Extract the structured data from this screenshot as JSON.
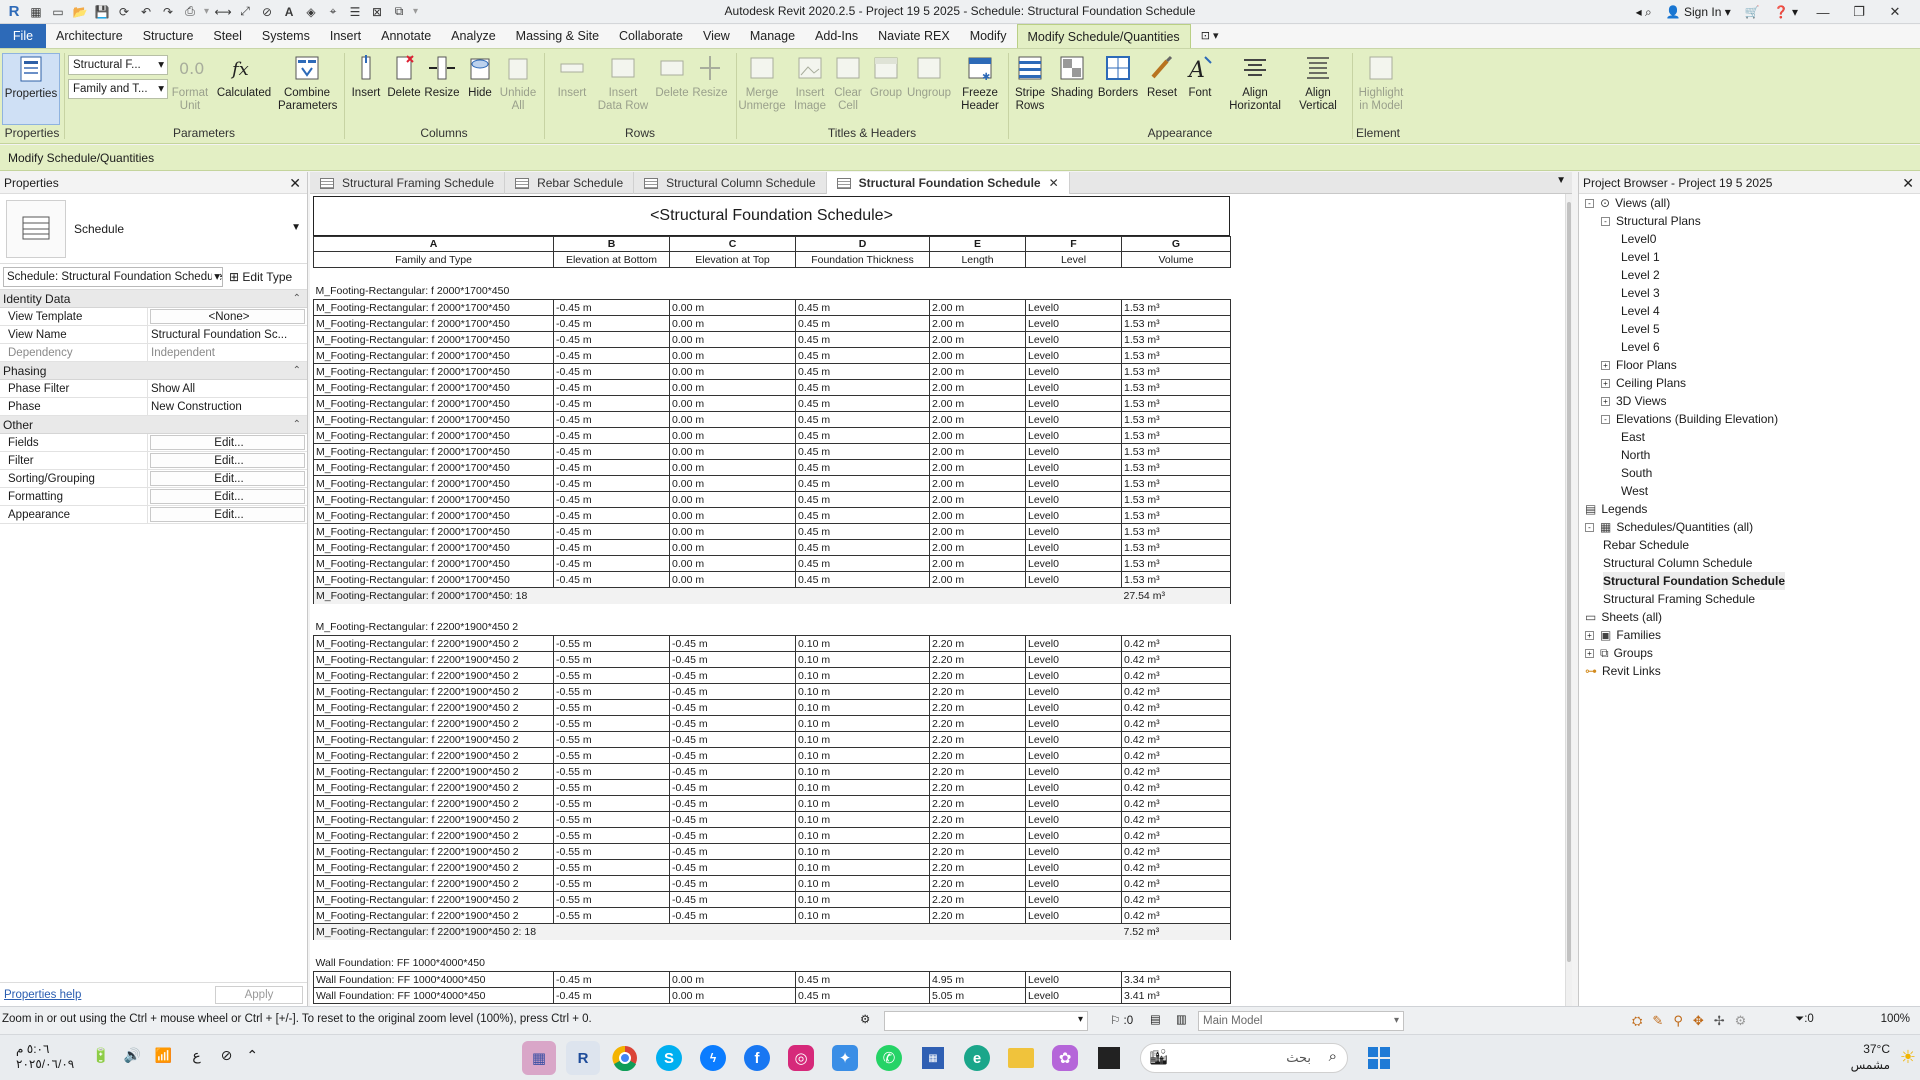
{
  "titlebar": {
    "title": "Autodesk Revit 2020.2.5 - Project   19 5 2025 - Schedule: Structural Foundation Schedule",
    "sign_in": "Sign In"
  },
  "ribbon_tabs": [
    "File",
    "Architecture",
    "Structure",
    "Steel",
    "Systems",
    "Insert",
    "Annotate",
    "Analyze",
    "Massing & Site",
    "Collaborate",
    "View",
    "Manage",
    "Add-Ins",
    "Naviate REX",
    "Modify",
    "Modify Schedule/Quantities"
  ],
  "ribbon": {
    "properties_label": "Properties",
    "param_dropdown1": "Structural F...",
    "param_dropdown2": "Family and T...",
    "buttons": {
      "format_unit": "Format\nUnit",
      "calculated": "Calculated",
      "combine_parameters": "Combine\nParameters",
      "insert_col": "Insert",
      "delete_col": "Delete",
      "resize_col": "Resize",
      "hide": "Hide",
      "unhide_all": "Unhide\nAll",
      "insert_row": "Insert",
      "insert_data_row": "Insert\nData Row",
      "delete_row": "Delete",
      "resize_row": "Resize",
      "merge_unmerge": "Merge\nUnmerge",
      "insert_image": "Insert\nImage",
      "clear_cell": "Clear\nCell",
      "group": "Group",
      "ungroup": "Ungroup",
      "freeze_header": "Freeze\nHeader",
      "stripe_rows": "Stripe\nRows",
      "shading": "Shading",
      "borders": "Borders",
      "reset": "Reset",
      "font": "Font",
      "align_horizontal": "Align\nHorizontal",
      "align_vertical": "Align\nVertical",
      "highlight_in_model": "Highlight\nin Model"
    },
    "groups": {
      "properties": "Properties",
      "parameters": "Parameters",
      "columns": "Columns",
      "rows": "Rows",
      "titles_headers": "Titles & Headers",
      "appearance": "Appearance",
      "element": "Element"
    }
  },
  "modify_bar": "Modify Schedule/Quantities",
  "properties": {
    "title": "Properties",
    "type_name": "Schedule",
    "selector": "Schedule: Structural Foundation Schedule",
    "edit_type": "Edit Type",
    "sections": {
      "identity": "Identity Data",
      "phasing": "Phasing",
      "other": "Other"
    },
    "identity_rows": [
      {
        "k": "View Template",
        "v": "<None>"
      },
      {
        "k": "View Name",
        "v": "Structural Foundation Sc..."
      },
      {
        "k": "Dependency",
        "v": "Independent"
      }
    ],
    "phasing_rows": [
      {
        "k": "Phase Filter",
        "v": "Show All"
      },
      {
        "k": "Phase",
        "v": "New Construction"
      }
    ],
    "other_rows": [
      {
        "k": "Fields",
        "v": "Edit..."
      },
      {
        "k": "Filter",
        "v": "Edit..."
      },
      {
        "k": "Sorting/Grouping",
        "v": "Edit..."
      },
      {
        "k": "Formatting",
        "v": "Edit..."
      },
      {
        "k": "Appearance",
        "v": "Edit..."
      }
    ],
    "help": "Properties help",
    "apply": "Apply"
  },
  "doc_tabs": [
    "Structural Framing Schedule",
    "Rebar Schedule",
    "Structural Column Schedule",
    "Structural Foundation Schedule"
  ],
  "schedule": {
    "title": "<Structural Foundation Schedule>",
    "letters": [
      "A",
      "B",
      "C",
      "D",
      "E",
      "F",
      "G"
    ],
    "headers": [
      "Family and Type",
      "Elevation at Bottom",
      "Elevation at Top",
      "Foundation Thickness",
      "Length",
      "Level",
      "Volume"
    ],
    "groups": [
      {
        "name": "M_Footing-Rectangular: f 2000*1700*450",
        "row": [
          "M_Footing-Rectangular: f 2000*1700*450",
          "-0.45 m",
          "0.00 m",
          "0.45 m",
          "2.00 m",
          "Level0",
          "1.53 m³"
        ],
        "count": 18,
        "total_label": "M_Footing-Rectangular: f 2000*1700*450: 18",
        "total": "27.54 m³"
      },
      {
        "name": "M_Footing-Rectangular: f 2200*1900*450 2",
        "row": [
          "M_Footing-Rectangular: f 2200*1900*450 2",
          "-0.55 m",
          "-0.45 m",
          "0.10 m",
          "2.20 m",
          "Level0",
          "0.42 m³"
        ],
        "count": 18,
        "total_label": "M_Footing-Rectangular: f 2200*1900*450 2: 18",
        "total": "7.52 m³"
      }
    ],
    "group3": {
      "name": "Wall Foundation: FF 1000*4000*450",
      "rows": [
        [
          "Wall Foundation: FF 1000*4000*450",
          "-0.45 m",
          "0.00 m",
          "0.45 m",
          "4.95 m",
          "Level0",
          "3.34 m³"
        ],
        [
          "Wall Foundation: FF 1000*4000*450",
          "-0.45 m",
          "0.00 m",
          "0.45 m",
          "5.05 m",
          "Level0",
          "3.41 m³"
        ]
      ]
    }
  },
  "browser": {
    "title": "Project Browser - Project   19 5 2025",
    "nodes": [
      {
        "label": "Views (all)",
        "level": 0,
        "exp": "-",
        "icon": "views-icon"
      },
      {
        "label": "Structural Plans",
        "level": 1,
        "exp": "-"
      },
      {
        "label": "Level0",
        "level": 2
      },
      {
        "label": "Level 1",
        "level": 2
      },
      {
        "label": "Level 2",
        "level": 2
      },
      {
        "label": "Level 3",
        "level": 2
      },
      {
        "label": "Level 4",
        "level": 2
      },
      {
        "label": "Level 5",
        "level": 2
      },
      {
        "label": "Level 6",
        "level": 2
      },
      {
        "label": "Floor Plans",
        "level": 1,
        "exp": "+"
      },
      {
        "label": "Ceiling Plans",
        "level": 1,
        "exp": "+"
      },
      {
        "label": "3D Views",
        "level": 1,
        "exp": "+"
      },
      {
        "label": "Elevations (Building Elevation)",
        "level": 1,
        "exp": "-"
      },
      {
        "label": "East",
        "level": 2
      },
      {
        "label": "North",
        "level": 2
      },
      {
        "label": "South",
        "level": 2
      },
      {
        "label": "West",
        "level": 2
      },
      {
        "label": "Legends",
        "level": 0,
        "icon": "legends-icon"
      },
      {
        "label": "Schedules/Quantities (all)",
        "level": 0,
        "exp": "-",
        "icon": "schedules-icon"
      },
      {
        "label": "Rebar Schedule",
        "level": 1
      },
      {
        "label": "Structural Column Schedule",
        "level": 1
      },
      {
        "label": "Structural Foundation Schedule",
        "level": 1,
        "selected": true
      },
      {
        "label": "Structural Framing Schedule",
        "level": 1
      },
      {
        "label": "Sheets (all)",
        "level": 0,
        "icon": "sheets-icon"
      },
      {
        "label": "Families",
        "level": 0,
        "exp": "+",
        "icon": "families-icon"
      },
      {
        "label": "Groups",
        "level": 0,
        "exp": "+",
        "icon": "groups-icon"
      },
      {
        "label": "Revit Links",
        "level": 0,
        "icon": "links-icon"
      }
    ]
  },
  "status": {
    "message": "Zoom in or out using the Ctrl + mouse wheel or Ctrl + [+/-]. To reset to the original zoom level (100%), press Ctrl + 0.",
    "zero": ":0",
    "model": "Main Model",
    "filter_count": ":0",
    "zoom": "100%"
  },
  "taskbar": {
    "time": "٥:٠٦ م",
    "date": "٢٠٢٥/٠٦/٠٩",
    "lang": "ع",
    "search": "بحث",
    "temp": "37°C",
    "weather": "مشمس"
  }
}
